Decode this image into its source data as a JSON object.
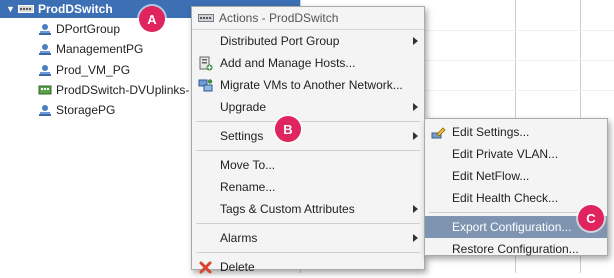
{
  "tree": {
    "root_label": "ProdDSwitch",
    "items": [
      {
        "label": "DPortGroup",
        "icon": "portgroup-icon"
      },
      {
        "label": "ManagementPG",
        "icon": "portgroup-icon"
      },
      {
        "label": "Prod_VM_PG",
        "icon": "portgroup-icon"
      },
      {
        "label": "ProdDSwitch-DVUplinks-",
        "icon": "uplink-icon"
      },
      {
        "label": "StoragePG",
        "icon": "portgroup-icon"
      }
    ]
  },
  "menu": {
    "header": "Actions - ProdDSwitch",
    "items": [
      {
        "label": "Distributed Port Group",
        "submenu": true
      },
      {
        "label": "Add and Manage Hosts...",
        "icon": "add-hosts-icon"
      },
      {
        "label": "Migrate VMs to Another Network...",
        "icon": "migrate-icon"
      },
      {
        "label": "Upgrade",
        "submenu": true
      },
      {
        "label": "Settings",
        "submenu": true
      },
      {
        "label": "Move To..."
      },
      {
        "label": "Rename..."
      },
      {
        "label": "Tags & Custom Attributes",
        "submenu": true
      },
      {
        "label": "Alarms",
        "submenu": true
      },
      {
        "label": "Delete",
        "icon": "delete-icon"
      }
    ]
  },
  "submenu": {
    "items": [
      {
        "label": "Edit Settings...",
        "icon": "edit-settings-icon"
      },
      {
        "label": "Edit Private VLAN..."
      },
      {
        "label": "Edit NetFlow..."
      },
      {
        "label": "Edit Health Check..."
      },
      {
        "label": "Export Configuration...",
        "highlighted": true
      },
      {
        "label": "Restore Configuration..."
      }
    ]
  },
  "callouts": {
    "a": "A",
    "b": "B",
    "c": "C"
  },
  "colors": {
    "selection": "#3d6fb5",
    "highlight": "#7e94b1",
    "callout": "#e0245e",
    "delete": "#d9432f"
  }
}
